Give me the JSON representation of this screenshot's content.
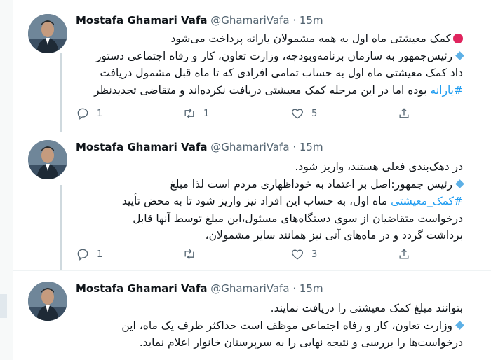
{
  "tweets": [
    {
      "name": "Mostafa Ghamari Vafa",
      "handle": "@GhamariVafa",
      "dot": "·",
      "time": "15m",
      "lines": [
        "کمک معیشتی ماه اول به همه مشمولان یارانه پرداخت می‌شود",
        "رئیس‌جمهور به سازمان برنامه‌وبودجه، وزارت تعاون، کار و رفاه اجتماعی دستور",
        "داد کمک معیشتی ماه اول به حساب تمامی افرادی که تا ماه قبل مشمول دریافت",
        "بوده اما در این مرحله کمک معیشتی دریافت نکرده‌اند و متقاضی تجدیدنظر"
      ],
      "hashtag": "#یارانه",
      "replies": "1",
      "retweets": "1",
      "likes": "5"
    },
    {
      "name": "Mostafa Ghamari Vafa",
      "handle": "@GhamariVafa",
      "dot": "·",
      "time": "15m",
      "lines": [
        "در دهک‌بندی فعلی هستند، واریز شود.",
        "رئیس جمهور:اصل بر اعتماد به خوداظهاری مردم است لذا مبلغ",
        "، به حساب این افراد نیز واریز شود تا به محض تأیید",
        "درخواست متقاضیان از سوی دستگاه‌های مسئول،این مبلغ توسط آنها قابل",
        "برداشت گردد و در ماه‌های آتی نیز همانند سایر مشمولان،"
      ],
      "hashtag": "#کمک_معیشتی",
      "hashtag_tail": "ماه اول",
      "replies": "1",
      "retweets": "",
      "likes": "3"
    },
    {
      "name": "Mostafa Ghamari Vafa",
      "handle": "@GhamariVafa",
      "dot": "·",
      "time": "15m",
      "lines": [
        "بتوانند مبلغ کمک معیشتی را دریافت نمایند.",
        "وزارت تعاون، کار و رفاه اجتماعی موظف است حداکثر ظرف یک ماه، این",
        "درخواست‌ها را بررسی و نتیجه نهایی را به سرپرستان خانوار اعلام نماید."
      ]
    }
  ]
}
